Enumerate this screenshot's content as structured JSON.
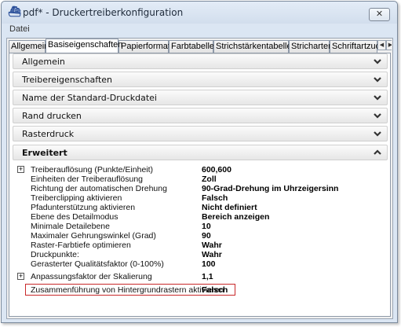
{
  "window": {
    "title": "pdf* - Druckertreiberkonfiguration",
    "close_glyph": "✕"
  },
  "menu": {
    "items": [
      "Datei"
    ]
  },
  "tabs": [
    {
      "label": "Allgemein",
      "active": false
    },
    {
      "label": "Basiseigenschaften",
      "active": true
    },
    {
      "label": "Papierformate",
      "active": false
    },
    {
      "label": "Farbtabellen",
      "active": false
    },
    {
      "label": "Strichstärkentabellen",
      "active": false
    },
    {
      "label": "Stricharten",
      "active": false
    },
    {
      "label": "Schriftartzuord",
      "active": false
    }
  ],
  "tab_scroll": {
    "left": "◀",
    "right": "▶"
  },
  "sections": [
    {
      "label": "Allgemein",
      "expanded": false
    },
    {
      "label": "Treibereigenschaften",
      "expanded": false
    },
    {
      "label": "Name der Standard-Druckdatei",
      "expanded": false
    },
    {
      "label": "Rand drucken",
      "expanded": false
    },
    {
      "label": "Rasterdruck",
      "expanded": false
    },
    {
      "label": "Erweitert",
      "expanded": true
    }
  ],
  "properties": [
    {
      "name": "Treiberauflösung (Punkte/Einheit)",
      "value": "600,600",
      "expander": "+"
    },
    {
      "name": "Einheiten der Treiberauflösung",
      "value": "Zoll",
      "expander": ""
    },
    {
      "name": "Richtung der automatischen Drehung",
      "value": "90-Grad-Drehung im Uhrzeigersinn",
      "expander": ""
    },
    {
      "name": "Treiberclipping aktivieren",
      "value": "Falsch",
      "expander": ""
    },
    {
      "name": "Pfadunterstützung aktivieren",
      "value": "Nicht definiert",
      "expander": ""
    },
    {
      "name": "Ebene des Detailmodus",
      "value": "Bereich anzeigen",
      "expander": ""
    },
    {
      "name": "Minimale Detailebene",
      "value": "10",
      "expander": ""
    },
    {
      "name": "Maximaler Gehrungswinkel (Grad)",
      "value": "90",
      "expander": ""
    },
    {
      "name": "Raster-Farbtiefe optimieren",
      "value": "Wahr",
      "expander": ""
    },
    {
      "name": "Druckpunkte:",
      "value": "Wahr",
      "expander": ""
    },
    {
      "name": "Gerasterter Qualitätsfaktor (0-100%)",
      "value": "100",
      "expander": ""
    },
    {
      "name": "Anpassungsfaktor der Skalierung",
      "value": "1,1",
      "expander": "+"
    },
    {
      "name": "Zusammenführung von Hintergrundrastern aktivieren",
      "value": "Falsch",
      "expander": ""
    }
  ],
  "colors": {
    "highlight": "#c8282a",
    "chevron": "#333333"
  }
}
